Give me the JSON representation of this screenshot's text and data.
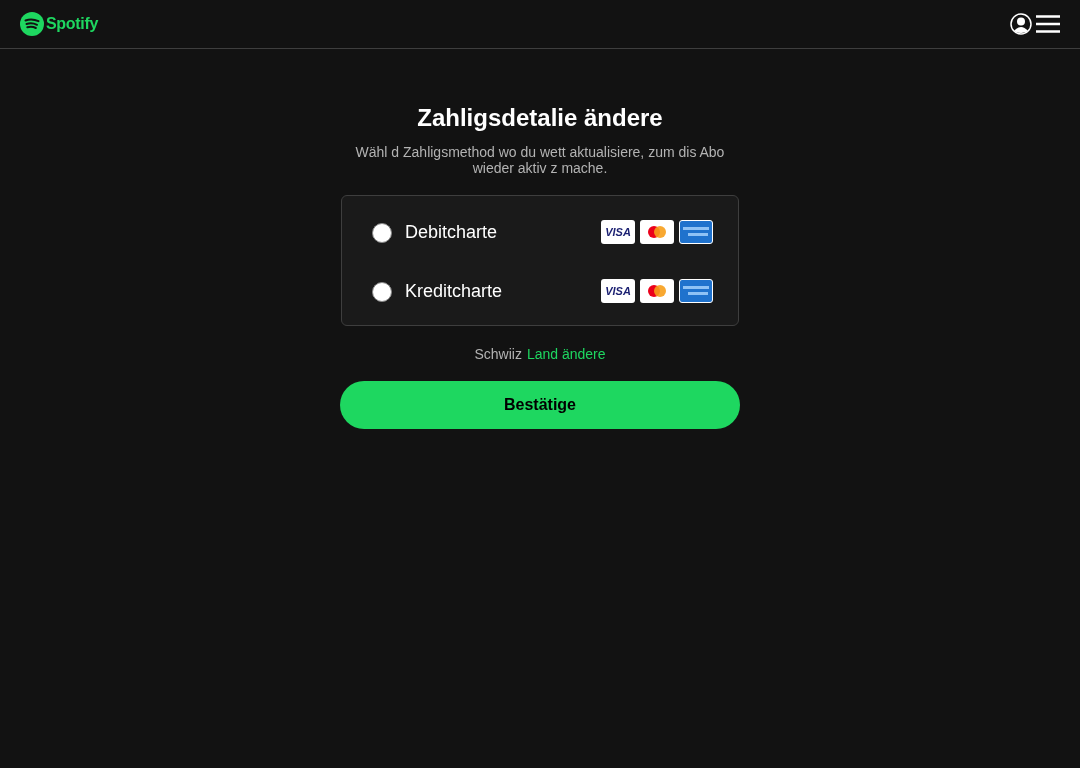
{
  "header": {
    "brand": "Spotify"
  },
  "title": "Zahligsdetalie ändere",
  "subtitle": "Wähl d Zahligsmethod wo du wett aktualisiere, zum dis Abo wieder aktiv z mache.",
  "payment_methods": [
    {
      "label": "Debitcharte",
      "selected": false,
      "cards": [
        {
          "kind": "visa",
          "text": "VISA"
        },
        {
          "kind": "mastercard"
        },
        {
          "kind": "amex"
        }
      ]
    },
    {
      "label": "Kreditcharte",
      "selected": false,
      "cards": [
        {
          "kind": "visa",
          "text": "VISA"
        },
        {
          "kind": "mastercard"
        },
        {
          "kind": "amex"
        }
      ]
    }
  ],
  "country": {
    "name": "Schwiiz",
    "link": "Land ändere"
  },
  "confirm_button": "Bestätige"
}
